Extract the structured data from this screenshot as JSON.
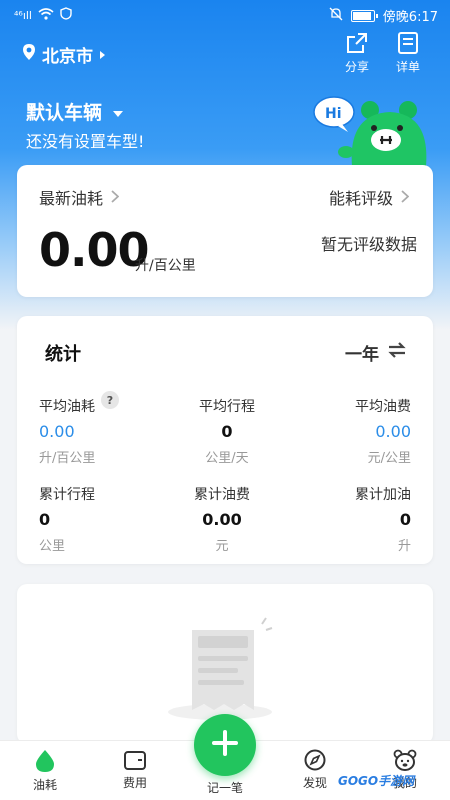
{
  "status_bar": {
    "signal": "⁴⁶ıll",
    "time_label": "傍晚6:17"
  },
  "header": {
    "city": "北京市",
    "share_label": "分享",
    "details_label": "详单",
    "vehicle_name": "默认车辆",
    "vehicle_subtitle": "还没有设置车型!",
    "mascot_badge": "Hi"
  },
  "fuel_card": {
    "latest_label": "最新油耗",
    "rating_label": "能耗评级",
    "value": "0.00",
    "unit": "升/百公里",
    "rating_value": "暂无评级数据"
  },
  "stats": {
    "title": "统计",
    "period": "一年",
    "items": [
      {
        "label": "平均油耗",
        "value": "0.00",
        "unit": "升/百公里",
        "has_help": true,
        "help": "?"
      },
      {
        "label": "平均行程",
        "value": "0",
        "unit": "公里/天"
      },
      {
        "label": "平均油费",
        "value": "0.00",
        "unit": "元/公里"
      },
      {
        "label": "累计行程",
        "value": "0",
        "unit": "公里"
      },
      {
        "label": "累计油费",
        "value": "0.00",
        "unit": "元"
      },
      {
        "label": "累计加油",
        "value": "0",
        "unit": "升"
      }
    ]
  },
  "tabs": [
    {
      "label": "油耗",
      "active": true
    },
    {
      "label": "费用"
    },
    {
      "label": "记一笔"
    },
    {
      "label": "发现"
    },
    {
      "label": "我的"
    }
  ],
  "watermark": "GOGO手游网",
  "colors": {
    "primary_blue": "#1a84ef",
    "accent_green": "#22c55e",
    "value_blue": "#2b8de8"
  }
}
